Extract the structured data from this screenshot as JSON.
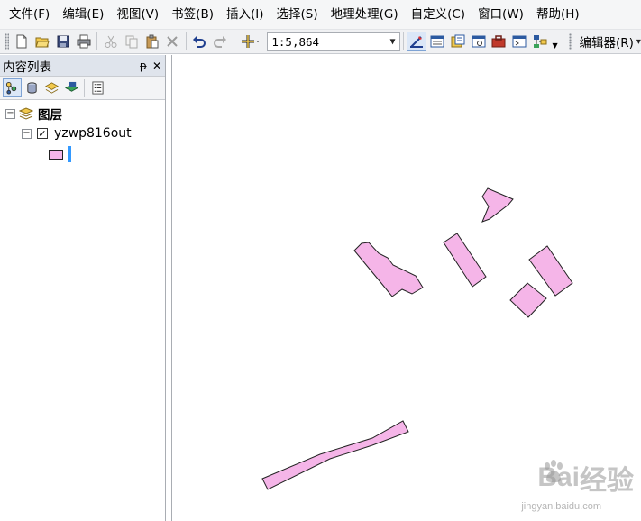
{
  "menu": [
    "文件(F)",
    "编辑(E)",
    "视图(V)",
    "书签(B)",
    "插入(I)",
    "选择(S)",
    "地理处理(G)",
    "自定义(C)",
    "窗口(W)",
    "帮助(H)"
  ],
  "toolbar": {
    "icons": [
      "new-document-icon",
      "open-folder-icon",
      "save-icon",
      "print-icon",
      "cut-icon",
      "copy-icon",
      "paste-icon",
      "delete-icon",
      "undo-icon",
      "redo-icon",
      "add-data-icon"
    ],
    "scale_value": "1:5,864",
    "tool_icons": [
      "editor-toolbar-icon",
      "table-of-contents-icon",
      "catalog-icon",
      "search-window-icon",
      "arctoolbox-icon",
      "python-window-icon",
      "modelbuilder-icon"
    ],
    "editor_label": "编辑器(R)"
  },
  "toc": {
    "title": "内容列表",
    "pin_glyph": "ᵽ",
    "close_glyph": "✕",
    "tools": [
      "list-by-drawing-order-icon",
      "list-by-source-icon",
      "list-by-visibility-icon",
      "list-by-selection-icon",
      "options-icon"
    ],
    "root_label": "图层",
    "layer_name": "yzwp816out",
    "layer_checked": true,
    "layer_fill": "#f5b5e8"
  },
  "map": {
    "feature_fill": "#f5b5e8",
    "feature_stroke": "#222222"
  },
  "watermark": {
    "brand_left": "Bai",
    "brand_right": "经验",
    "url": "jingyan.baidu.com"
  }
}
